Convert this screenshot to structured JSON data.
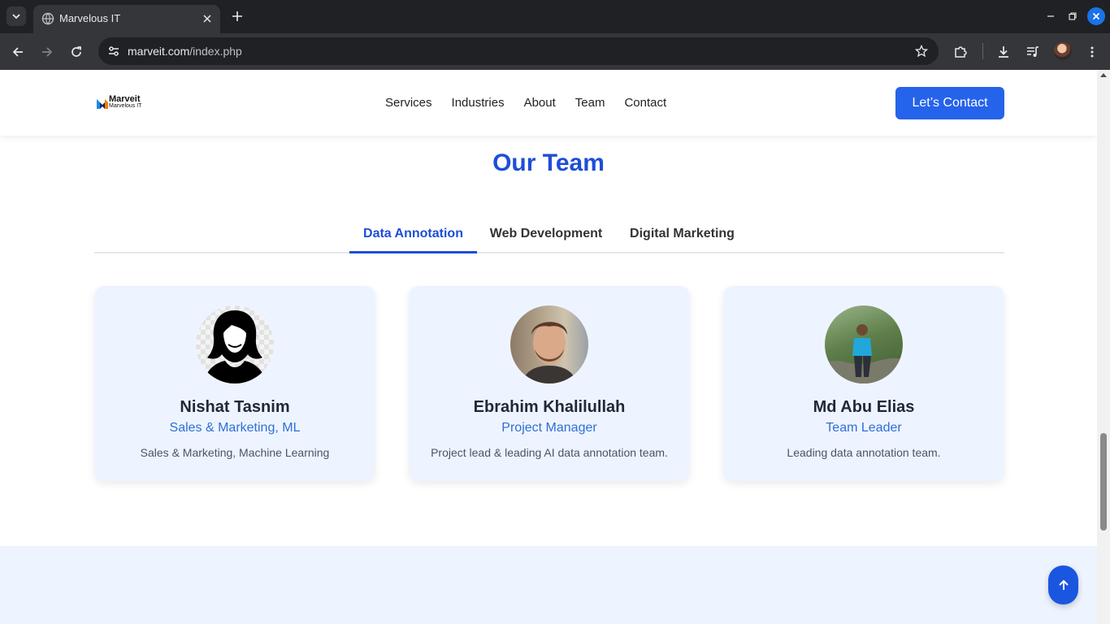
{
  "browser": {
    "tab_title": "Marvelous IT",
    "url_host": "marveit.com",
    "url_path": "/index.php"
  },
  "site": {
    "logo_name": "Marveit",
    "logo_sub": "Marvelous IT",
    "nav": [
      "Services",
      "Industries",
      "About",
      "Team",
      "Contact"
    ],
    "cta_label": "Let’s Contact"
  },
  "team": {
    "title": "Our Team",
    "tabs": [
      "Data Annotation",
      "Web Development",
      "Digital Marketing"
    ],
    "active_tab": "Data Annotation",
    "members": [
      {
        "name": "Nishat Tasnim",
        "role": "Sales & Marketing, ML",
        "desc": "Sales & Marketing, Machine Learning",
        "photo": "silhouette-avatar"
      },
      {
        "name": "Ebrahim Khalilullah",
        "role": "Project Manager",
        "desc": "Project lead & leading AI data annotation team.",
        "photo": "portrait-photo"
      },
      {
        "name": "Md Abu Elias",
        "role": "Team Leader",
        "desc": "Leading data annotation team.",
        "photo": "outdoor-photo"
      }
    ]
  },
  "colors": {
    "accent": "#1d4ed8",
    "cta": "#2563eb",
    "card_bg": "#eef4ff",
    "role_text": "#2f6fd6"
  }
}
